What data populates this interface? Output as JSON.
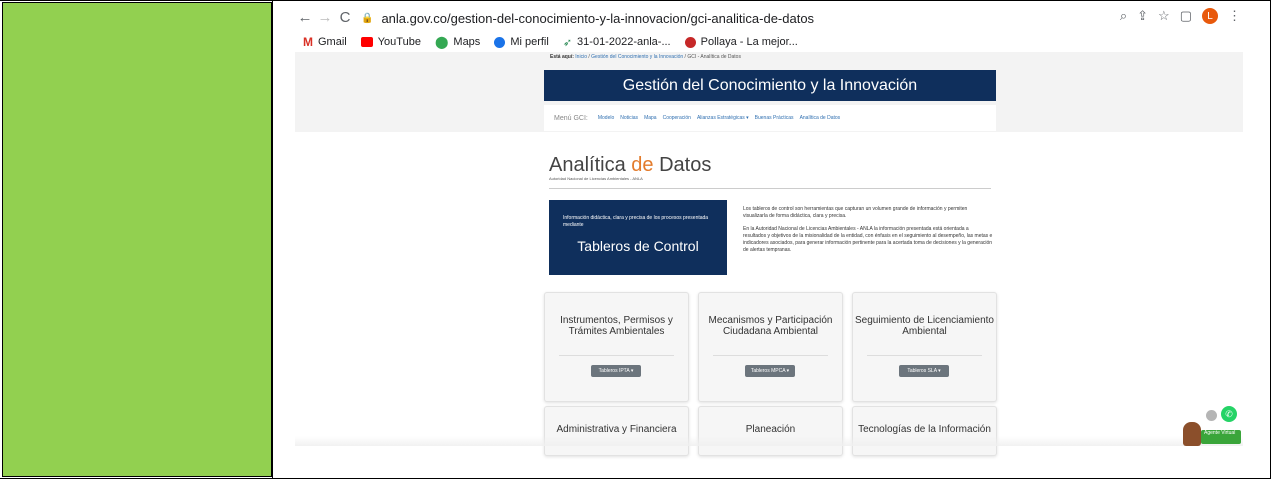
{
  "browser": {
    "url": "anla.gov.co/gestion-del-conocimiento-y-la-innovacion/gci-analitica-de-datos",
    "profile_initial": "L",
    "bookmarks": [
      {
        "label": "Gmail"
      },
      {
        "label": "YouTube"
      },
      {
        "label": "Maps"
      },
      {
        "label": "Mi perfil"
      },
      {
        "label": "31-01-2022-anla-..."
      },
      {
        "label": "Pollaya - La mejor..."
      }
    ]
  },
  "page": {
    "breadcrumb": {
      "prefix": "Está aquí:",
      "inicio": "Inicio",
      "section": "Gestión del Conocimiento y la Innovación",
      "current": "GCI - Analítica de Datos"
    },
    "banner_title": "Gestión del Conocimiento y la Innovación",
    "menu": {
      "label": "Menú GCI:",
      "items": [
        "Modelo",
        "Noticias",
        "Mapa",
        "Cooperación",
        "Alianzas Estratégicas ▾",
        "Buenas Prácticas",
        "Analítica de Datos"
      ]
    },
    "heading": {
      "word1": "Analítica ",
      "word2": "de",
      "word3": " Datos"
    },
    "subheading": "Autoridad Nacional de Licencias Ambientales - ANLA",
    "dash_box": {
      "small_text": "Información didáctica, clara y precisa de los procesos presentada mediante",
      "big_text": "Tableros de Control"
    },
    "description": [
      "Los tableros de control son herramientas que capturan un volumen grande de información y permiten visualizarla de forma didáctica, clara y precisa.",
      "En la Autoridad Nacional de Licencias Ambientales - ANLA la información presentada está orientada a resultados y objetivos de la misionalidad de la entidad, con énfasis en el seguimiento al desempeño, las metas e indicadores asociados, para generar información pertinente para la acertada toma de decisiones y la generación de alertas tempranas."
    ],
    "cards": [
      {
        "title": "Instrumentos, Permisos y Trámites Ambientales",
        "button": "Tableros IPTA ▾"
      },
      {
        "title": "Mecanismos y Participación Ciudadana Ambiental",
        "button": "Tableros MPCA ▾"
      },
      {
        "title": "Seguimiento de Licenciamiento Ambiental",
        "button": "Tableros SLA ▾"
      }
    ],
    "cards_row2": [
      {
        "title": "Administrativa y Financiera"
      },
      {
        "title": "Planeación"
      },
      {
        "title": "Tecnologías de la Información"
      }
    ],
    "agent_label": "Agente Virtual"
  },
  "colors": {
    "green_panel": "#92d050",
    "navy": "#0f2f5c",
    "accent": "#e37b2c"
  }
}
